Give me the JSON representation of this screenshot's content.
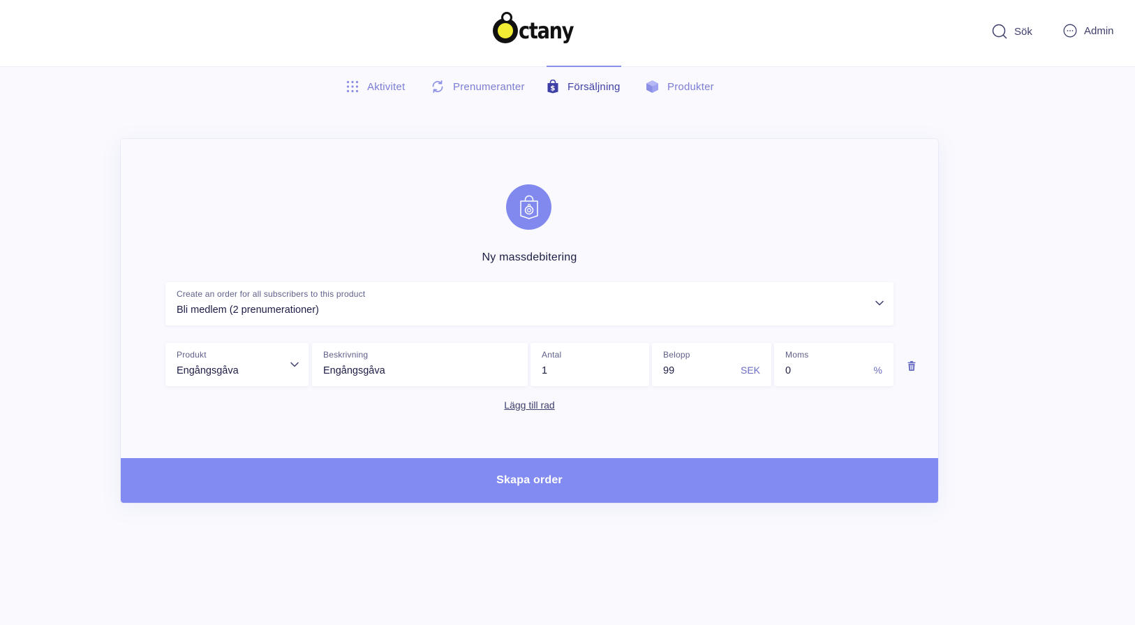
{
  "brand": {
    "logo_text": "ctany"
  },
  "header": {
    "search_label": "Sök",
    "admin_label": "Admin"
  },
  "nav": {
    "items": [
      {
        "label": "Aktivitet",
        "active": false
      },
      {
        "label": "Prenumeranter",
        "active": false
      },
      {
        "label": "Försäljning",
        "active": true
      },
      {
        "label": "Produkter",
        "active": false
      }
    ]
  },
  "form": {
    "title": "Ny massdebitering",
    "subscription": {
      "label": "Create an order for all subscribers to this product",
      "value": "Bli medlem (2 prenumerationer)"
    },
    "row": {
      "product": {
        "label": "Produkt",
        "value": "Engångsgåva"
      },
      "description": {
        "label": "Beskrivning",
        "value": "Engångsgåva"
      },
      "quantity": {
        "label": "Antal",
        "value": "1"
      },
      "amount": {
        "label": "Belopp",
        "value": "99",
        "suffix": "SEK"
      },
      "vat": {
        "label": "Moms",
        "value": "0",
        "suffix": "%"
      }
    },
    "add_row_label": "Lägg till rad",
    "submit_label": "Skapa order"
  },
  "colors": {
    "accent": "#828bf2",
    "nav_inactive": "#7c7dd6",
    "nav_active": "#3f40a6",
    "page_bg": "#f9f9fe"
  }
}
